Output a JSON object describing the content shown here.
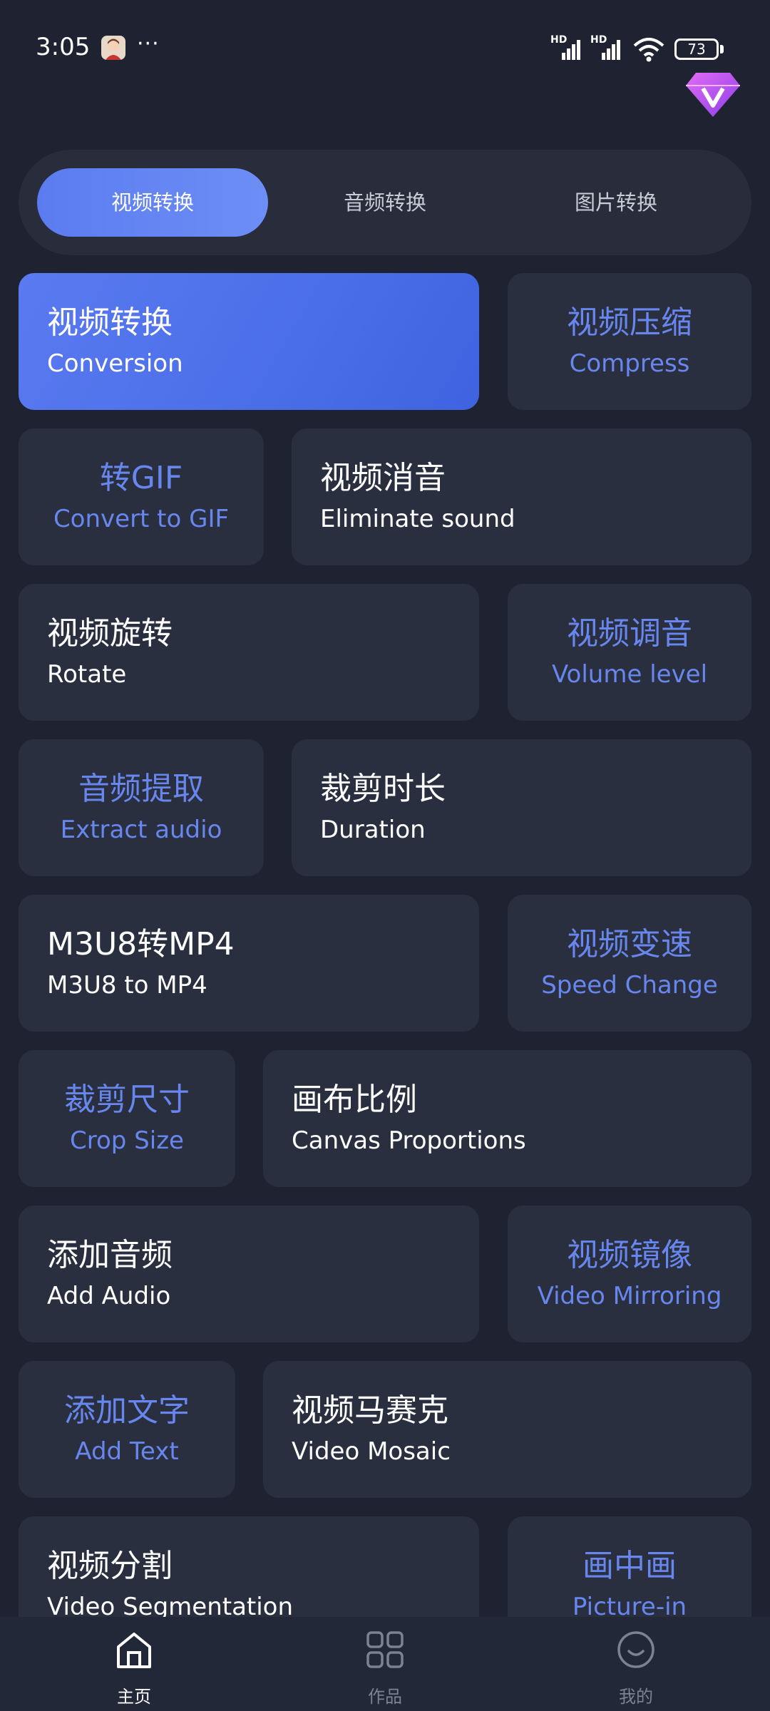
{
  "status_bar": {
    "time": "3:05",
    "more": "···",
    "network_1": "HD",
    "network_2": "HD",
    "battery": "73"
  },
  "tabs": [
    {
      "label": "视频转换",
      "active": true
    },
    {
      "label": "音频转换",
      "active": false
    },
    {
      "label": "图片转换",
      "active": false
    }
  ],
  "tools": {
    "conversion": {
      "cn": "视频转换",
      "en": "Conversion"
    },
    "compress": {
      "cn": "视频压缩",
      "en": "Compress"
    },
    "gif": {
      "cn": "转GIF",
      "en": "Convert to GIF"
    },
    "eliminate_sound": {
      "cn": "视频消音",
      "en": "Eliminate sound"
    },
    "rotate": {
      "cn": "视频旋转",
      "en": "Rotate"
    },
    "volume": {
      "cn": "视频调音",
      "en": "Volume level"
    },
    "extract_audio": {
      "cn": "音频提取",
      "en": "Extract audio"
    },
    "duration": {
      "cn": "裁剪时长",
      "en": "Duration"
    },
    "m3u8": {
      "cn": "M3U8转MP4",
      "en": "M3U8 to MP4"
    },
    "speed": {
      "cn": "视频变速",
      "en": "Speed Change"
    },
    "crop_size": {
      "cn": "裁剪尺寸",
      "en": "Crop Size"
    },
    "canvas": {
      "cn": "画布比例",
      "en": "Canvas Proportions"
    },
    "add_audio": {
      "cn": "添加音频",
      "en": "Add Audio"
    },
    "mirroring": {
      "cn": "视频镜像",
      "en": "Video Mirroring"
    },
    "add_text": {
      "cn": "添加文字",
      "en": "Add Text"
    },
    "mosaic": {
      "cn": "视频马赛克",
      "en": "Video Mosaic"
    },
    "segmentation": {
      "cn": "视频分割",
      "en": "Video Segmentation"
    },
    "pip": {
      "cn": "画中画",
      "en": "Picture-in"
    }
  },
  "bottom_nav": [
    {
      "label": "主页",
      "icon": "home-icon",
      "active": true
    },
    {
      "label": "作品",
      "icon": "grid-icon",
      "active": false
    },
    {
      "label": "我的",
      "icon": "smile-icon",
      "active": false
    }
  ],
  "colors": {
    "background": "#1f2331",
    "card": "#2a2f3f",
    "accent": "#6887ee",
    "hero": "#4a6ee8"
  }
}
